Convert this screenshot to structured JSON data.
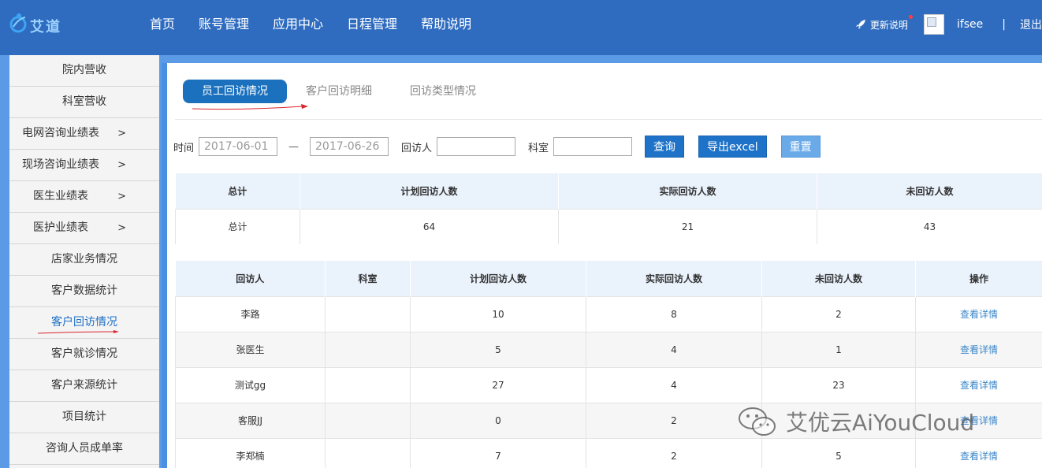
{
  "brand": {
    "logo_text": "艾道"
  },
  "nav": [
    "首页",
    "账号管理",
    "应用中心",
    "日程管理",
    "帮助说明"
  ],
  "header_right": {
    "update_label": "更新说明",
    "username": "ifsee",
    "separator": "|",
    "logout": "退出"
  },
  "sidebar": {
    "items": [
      {
        "label": "院内营收",
        "arrow": ""
      },
      {
        "label": "科室营收",
        "arrow": ""
      },
      {
        "label": "电网咨询业绩表",
        "arrow": ">"
      },
      {
        "label": "现场咨询业绩表",
        "arrow": ">"
      },
      {
        "label": "医生业绩表",
        "arrow": ">"
      },
      {
        "label": "医护业绩表",
        "arrow": ">"
      },
      {
        "label": "店家业务情况",
        "arrow": ""
      },
      {
        "label": "客户数据统计",
        "arrow": ""
      },
      {
        "label": "客户回访情况",
        "arrow": ""
      },
      {
        "label": "客户就诊情况",
        "arrow": ""
      },
      {
        "label": "客户来源统计",
        "arrow": ""
      },
      {
        "label": "项目统计",
        "arrow": ""
      },
      {
        "label": "咨询人员成单率",
        "arrow": ""
      }
    ]
  },
  "tabs": [
    "员工回访情况",
    "客户回访明细",
    "回访类型情况"
  ],
  "filter": {
    "time_label": "时间",
    "start_date": "2017-06-01",
    "range_sep": "—",
    "end_date": "2017-06-26",
    "visitor_label": "回访人",
    "visitor_value": "",
    "dept_label": "科室",
    "dept_value": "",
    "query_btn": "查询",
    "export_btn": "导出excel",
    "reset_btn": "重置"
  },
  "summary_table": {
    "headers": [
      "总计",
      "计划回访人数",
      "实际回访人数",
      "未回访人数"
    ],
    "row": [
      "总计",
      "64",
      "21",
      "43"
    ]
  },
  "detail_table": {
    "headers": [
      "回访人",
      "科室",
      "计划回访人数",
      "实际回访人数",
      "未回访人数",
      "操作"
    ],
    "rows": [
      {
        "name": "李路",
        "dept": "",
        "plan": "10",
        "actual": "8",
        "unvisited": "2",
        "action": "查看详情"
      },
      {
        "name": "张医生",
        "dept": "",
        "plan": "5",
        "actual": "4",
        "unvisited": "1",
        "action": "查看详情"
      },
      {
        "name": "测试gg",
        "dept": "",
        "plan": "27",
        "actual": "4",
        "unvisited": "23",
        "action": "查看详情"
      },
      {
        "name": "客服JJ",
        "dept": "",
        "plan": "0",
        "actual": "2",
        "unvisited": "",
        "action": "查看详情"
      },
      {
        "name": "李郑楠",
        "dept": "",
        "plan": "7",
        "actual": "2",
        "unvisited": "5",
        "action": "查看详情"
      }
    ]
  },
  "watermark": {
    "text": "艾优云AiYouCloud"
  },
  "colors": {
    "header_bg": "#2f6cc0",
    "frame": "#5b9be6",
    "primary_btn": "#1e73c8",
    "link": "#3a86c8",
    "annotation": "#d9252b"
  }
}
